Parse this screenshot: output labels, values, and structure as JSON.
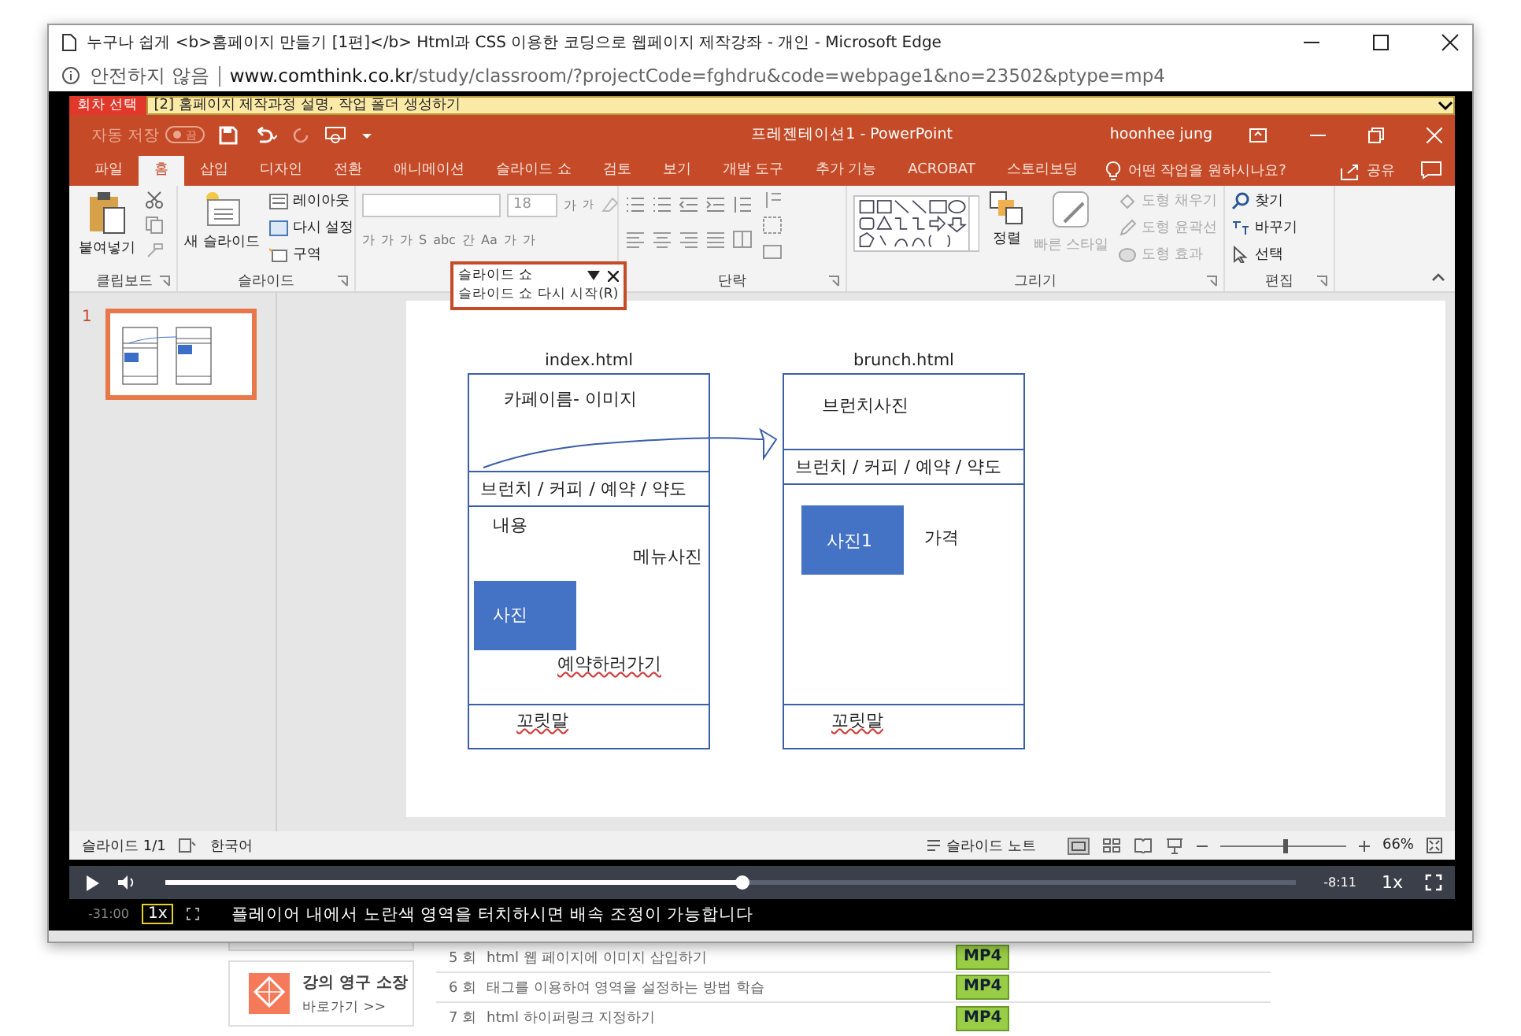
{
  "browser": {
    "title": "누구나 쉽게 <b>홈페이지 만들기 [1편]</b> Html과 CSS 이용한 코딩으로 웹페이지 제작강좌 - 개인 - Microsoft Edge",
    "security": "안전하지 않음",
    "url_host": "www.comthink.co.kr",
    "url_path": "/study/classroom/?projectCode=fghdru&code=webpage1&no=23502&ptype=mp4"
  },
  "episode_select": {
    "label": "회차 선택",
    "value": "[2] 홈페이지 제작과정 설명, 작업 폴더 생성하기"
  },
  "powerpoint": {
    "autosave": {
      "label": "자동 저장",
      "on": false,
      "state": "끔"
    },
    "title": "프레젠테이션1 - PowerPoint",
    "user": "hoonhee jung",
    "tabs": [
      {
        "label": "파일",
        "selected": false
      },
      {
        "label": "홈",
        "selected": true
      },
      {
        "label": "삽입",
        "selected": false
      },
      {
        "label": "디자인",
        "selected": false
      },
      {
        "label": "전환",
        "selected": false
      },
      {
        "label": "애니메이션",
        "selected": false
      },
      {
        "label": "슬라이드 쇼",
        "selected": false
      },
      {
        "label": "검토",
        "selected": false
      },
      {
        "label": "보기",
        "selected": false
      },
      {
        "label": "개발 도구",
        "selected": false
      },
      {
        "label": "추가 기능",
        "selected": false
      },
      {
        "label": "ACROBAT",
        "selected": false
      },
      {
        "label": "스토리보딩",
        "selected": false
      }
    ],
    "tell_me": "어떤 작업을 원하시나요?",
    "share": "공유",
    "ribbon": {
      "clipboard": {
        "label": "클립보드",
        "paste": "붙여넣기"
      },
      "slides": {
        "label": "슬라이드",
        "new_slide": "새 슬라이드",
        "layout": "레이아웃",
        "reset": "다시 설정",
        "section": "구역"
      },
      "font": {
        "size": "18",
        "grow": "가",
        "shrink": "가",
        "buttons": [
          "가",
          "가",
          "가",
          "S",
          "abc",
          "간",
          "Aa",
          "가",
          "가"
        ]
      },
      "paragraph": {
        "label": "단락"
      },
      "drawing": {
        "label": "그리기",
        "arrange": "정렬",
        "quick_styles": "빠른 스타일",
        "fill": "도형 채우기",
        "outline": "도형 윤곽선",
        "effects": "도형 효과"
      },
      "editing": {
        "label": "편집",
        "find": "찾기",
        "replace": "바꾸기",
        "select": "선택"
      }
    },
    "popup": {
      "title": "슬라이드 쇼",
      "item": "슬라이드 쇼 다시 시작(R)"
    },
    "thumbnails": [
      {
        "number": "1",
        "selected": true
      }
    ],
    "pages": [
      {
        "filename": "index.html",
        "header": "카페이름- 이미지",
        "nav": "브런치 / 커피 / 예약 / 약도",
        "photo": "사진",
        "texts": [
          "내용",
          "메뉴사진",
          "예약하러가기"
        ],
        "footer": "꼬릿말"
      },
      {
        "filename": "brunch.html",
        "header": "브런치사진",
        "nav": "브런치 / 커피 / 예약 / 약도",
        "photo": "사진1",
        "texts": [
          "가격"
        ],
        "footer": "꼬릿말"
      }
    ],
    "status": {
      "slide": "슬라이드 1/1",
      "language": "한국어",
      "notes": "슬라이드 노트",
      "zoom": "66%",
      "zoom_level": {
        "level": 0.5
      }
    }
  },
  "video": {
    "level": 0.51,
    "remaining": "-8:11",
    "speed": "1x"
  },
  "subtitle_row": {
    "time": "-31:00",
    "speed": "1x",
    "message": "플레이어 내에서 노란색 영역을 터치하시면 배속 조정이 가능합니다"
  },
  "page": {
    "keep_card": {
      "title": "강의 영구 소장",
      "link": "바로가기 >>"
    },
    "lessons": [
      {
        "number": "5 회",
        "title": "html 웹 페이지에 이미지 삽입하기",
        "format": "MP4"
      },
      {
        "number": "6 회",
        "title": "태그를 이용하여 영역을 설정하는 방법 학습",
        "format": "MP4"
      },
      {
        "number": "7 회",
        "title": "html 하이퍼링크 지정하기",
        "format": "MP4"
      }
    ]
  }
}
